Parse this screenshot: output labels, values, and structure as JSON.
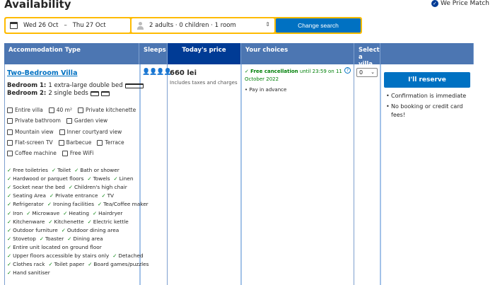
{
  "page": {
    "title": "Availability",
    "price_match": "We Price Match"
  },
  "search": {
    "checkin": "Wed 26 Oct",
    "checkout": "Thu 27 Oct",
    "guests": "2 adults · 0 children · 1 room",
    "button": "Change search"
  },
  "table": {
    "headers": [
      "Accommodation Type",
      "Sleeps",
      "Today's price",
      "Your choices",
      "Select a villa",
      ""
    ]
  },
  "room": {
    "name": "Two-Bedroom Villa",
    "bedrooms": [
      {
        "label": "Bedroom 1:",
        "text": "1 extra-large double bed"
      },
      {
        "label": "Bedroom 2:",
        "text": "2 single beds"
      }
    ],
    "features": [
      [
        "Entire villa",
        "40 m²",
        "Private kitchenette"
      ],
      [
        "Private bathroom",
        "Garden view"
      ],
      [
        "Mountain view",
        "Inner courtyard view"
      ],
      [
        "Flat-screen TV",
        "Barbecue",
        "Terrace"
      ],
      [
        "Coffee machine",
        "Free WiFi"
      ]
    ],
    "amenities": [
      [
        "Free toiletries",
        "Toilet",
        "Bath or shower"
      ],
      [
        "Hardwood or parquet floors",
        "Towels",
        "Linen"
      ],
      [
        "Socket near the bed",
        "Children's high chair"
      ],
      [
        "Seating Area",
        "Private entrance",
        "TV"
      ],
      [
        "Refrigerator",
        "Ironing facilities",
        "Tea/Coffee maker"
      ],
      [
        "Iron",
        "Microwave",
        "Heating",
        "Hairdryer"
      ],
      [
        "Kitchenware",
        "Kitchenette",
        "Electric kettle"
      ],
      [
        "Outdoor furniture",
        "Outdoor dining area"
      ],
      [
        "Stovetop",
        "Toaster",
        "Dining area"
      ],
      [
        "Entire unit located on ground floor"
      ],
      [
        "Upper floors accessible by stairs only",
        "Detached"
      ],
      [
        "Clothes rack",
        "Toilet paper",
        "Board games/puzzles"
      ],
      [
        "Hand sanitiser"
      ]
    ],
    "sleeps": "👤👤👤👤",
    "price": "660 lei",
    "price_note": "Includes taxes and charges",
    "choice_cancel_bold": "Free cancellation",
    "choice_cancel_rest": "until 23:59 on 11 October 2022",
    "choice_pay": "Pay in advance",
    "select_value": "0",
    "reserve_label": "I'll reserve",
    "bullets": [
      "Confirmation is immediate",
      "No booking or credit card fees!"
    ]
  }
}
